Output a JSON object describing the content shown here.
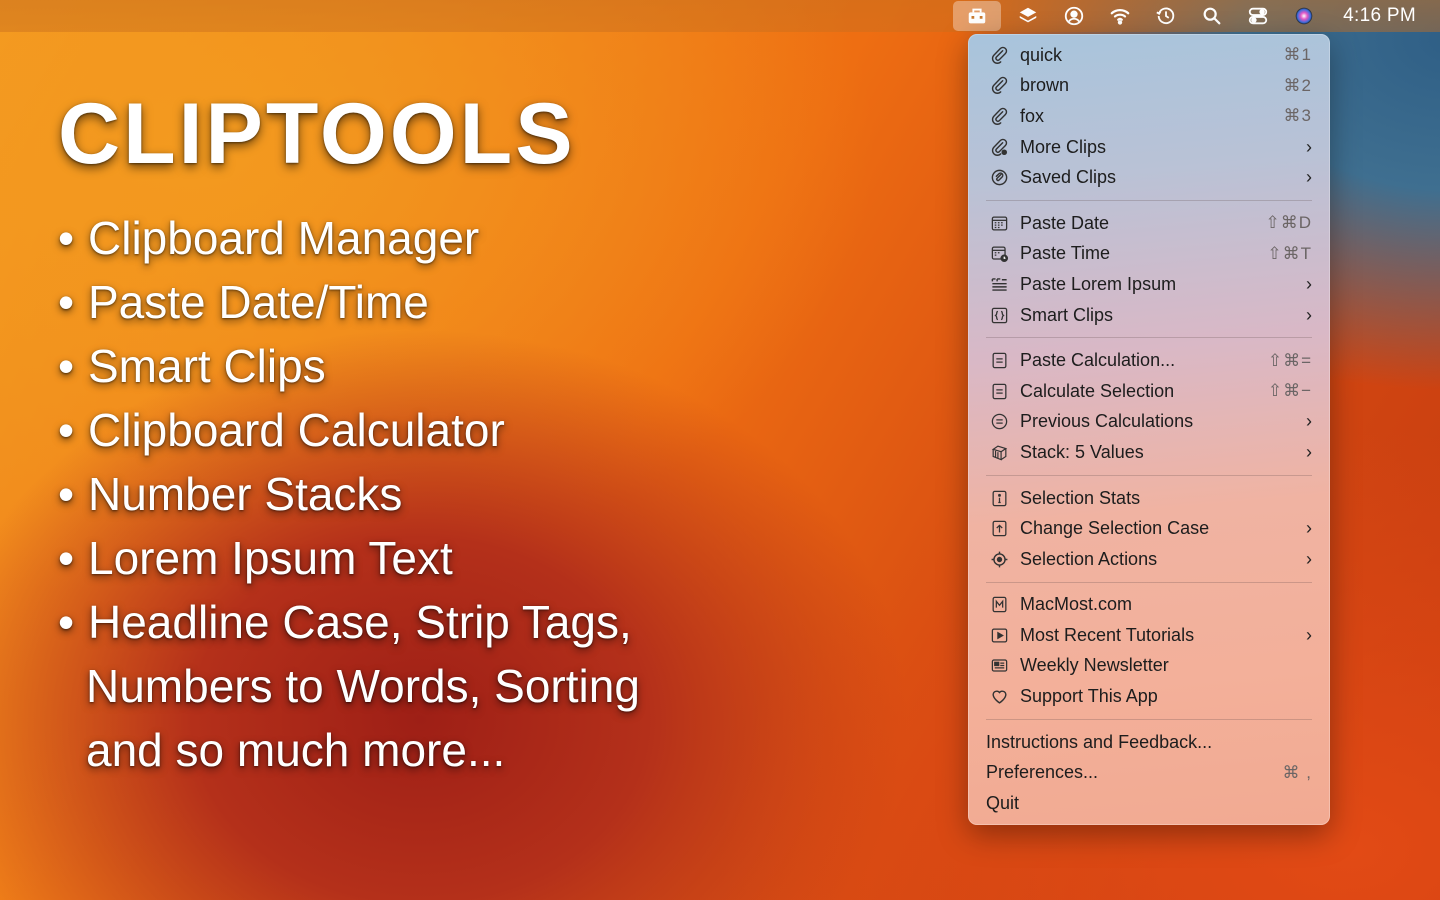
{
  "menubar": {
    "clock": "4:16 PM",
    "icons": [
      "toolbox-icon",
      "layers-icon",
      "user-circle-icon",
      "wifi-icon",
      "time-machine-icon",
      "spotlight-search-icon",
      "control-center-icon",
      "siri-icon"
    ]
  },
  "hero": {
    "title": "CLIPTOOLS",
    "features": [
      "Clipboard Manager",
      "Paste Date/Time",
      "Smart Clips",
      "Clipboard Calculator",
      "Number Stacks",
      "Lorem Ipsum Text",
      "Headline Case, Strip Tags,"
    ],
    "continuation": [
      "Numbers to Words, Sorting",
      "and so much more..."
    ]
  },
  "menu": {
    "group1": [
      {
        "label": "quick",
        "shortcut": "⌘1",
        "icon": "paperclip-icon"
      },
      {
        "label": "brown",
        "shortcut": "⌘2",
        "icon": "paperclip-icon"
      },
      {
        "label": "fox",
        "shortcut": "⌘3",
        "icon": "paperclip-icon"
      },
      {
        "label": "More Clips",
        "shortcut": "",
        "icon": "paperclip-more-icon",
        "submenu": true
      },
      {
        "label": "Saved Clips",
        "shortcut": "",
        "icon": "saved-clip-icon",
        "submenu": true
      }
    ],
    "group2": [
      {
        "label": "Paste Date",
        "shortcut": "⇧⌘D",
        "icon": "calendar-icon"
      },
      {
        "label": "Paste Time",
        "shortcut": "⇧⌘T",
        "icon": "calendar-clock-icon"
      },
      {
        "label": "Paste Lorem Ipsum",
        "shortcut": "",
        "icon": "quote-text-icon",
        "submenu": true
      },
      {
        "label": "Smart Clips",
        "shortcut": "",
        "icon": "braces-icon",
        "submenu": true
      }
    ],
    "group3": [
      {
        "label": "Paste Calculation...",
        "shortcut": "⇧⌘=",
        "icon": "equals-square-icon"
      },
      {
        "label": "Calculate Selection",
        "shortcut": "⇧⌘−",
        "icon": "equals-square-icon"
      },
      {
        "label": "Previous Calculations",
        "shortcut": "",
        "icon": "equals-circle-icon",
        "submenu": true
      },
      {
        "label": "Stack: 5 Values",
        "shortcut": "",
        "icon": "stack-icon",
        "submenu": true
      }
    ],
    "group4": [
      {
        "label": "Selection Stats",
        "shortcut": "",
        "icon": "info-square-icon"
      },
      {
        "label": "Change Selection Case",
        "shortcut": "",
        "icon": "arrow-up-square-icon",
        "submenu": true
      },
      {
        "label": "Selection Actions",
        "shortcut": "",
        "icon": "gear-eye-icon",
        "submenu": true
      }
    ],
    "group5": [
      {
        "label": "MacMost.com",
        "shortcut": "",
        "icon": "m-square-icon"
      },
      {
        "label": "Most Recent Tutorials",
        "shortcut": "",
        "icon": "play-square-icon",
        "submenu": true
      },
      {
        "label": "Weekly Newsletter",
        "shortcut": "",
        "icon": "newsletter-icon"
      },
      {
        "label": "Support This App",
        "shortcut": "",
        "icon": "heart-icon"
      }
    ],
    "group6": [
      {
        "label": "Instructions and Feedback...",
        "shortcut": ""
      },
      {
        "label": "Preferences...",
        "shortcut": "⌘ ,"
      },
      {
        "label": "Quit",
        "shortcut": ""
      }
    ]
  }
}
